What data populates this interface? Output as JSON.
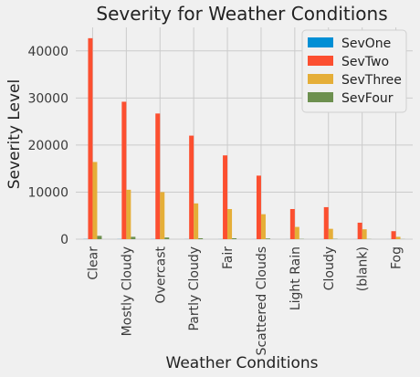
{
  "chart_data": {
    "type": "bar",
    "title": "Severity for Weather Conditions",
    "xlabel": "Weather Conditions",
    "ylabel": "Severity Level",
    "categories": [
      "Clear",
      "Mostly Cloudy",
      "Overcast",
      "Partly Cloudy",
      "Fair",
      "Scattered Clouds",
      "Light Rain",
      "Cloudy",
      "(blank)",
      "Fog"
    ],
    "series": [
      {
        "name": "SevOne",
        "color": "#008fd5",
        "values": [
          30,
          20,
          20,
          15,
          10,
          10,
          5,
          5,
          5,
          5
        ]
      },
      {
        "name": "SevTwo",
        "color": "#fc4f30",
        "values": [
          42700,
          29200,
          26700,
          22000,
          17800,
          13500,
          6400,
          6800,
          3500,
          1700
        ]
      },
      {
        "name": "SevThree",
        "color": "#e5ae38",
        "values": [
          16400,
          10500,
          10000,
          7600,
          6400,
          5300,
          2600,
          2200,
          2100,
          500
        ]
      },
      {
        "name": "SevFour",
        "color": "#6d904f",
        "values": [
          700,
          500,
          350,
          200,
          200,
          150,
          50,
          60,
          30,
          20
        ]
      }
    ],
    "ylim": [
      0,
      45000
    ],
    "yticks": [
      0,
      10000,
      20000,
      30000,
      40000
    ],
    "grid": true,
    "legend_position": "top-right"
  }
}
